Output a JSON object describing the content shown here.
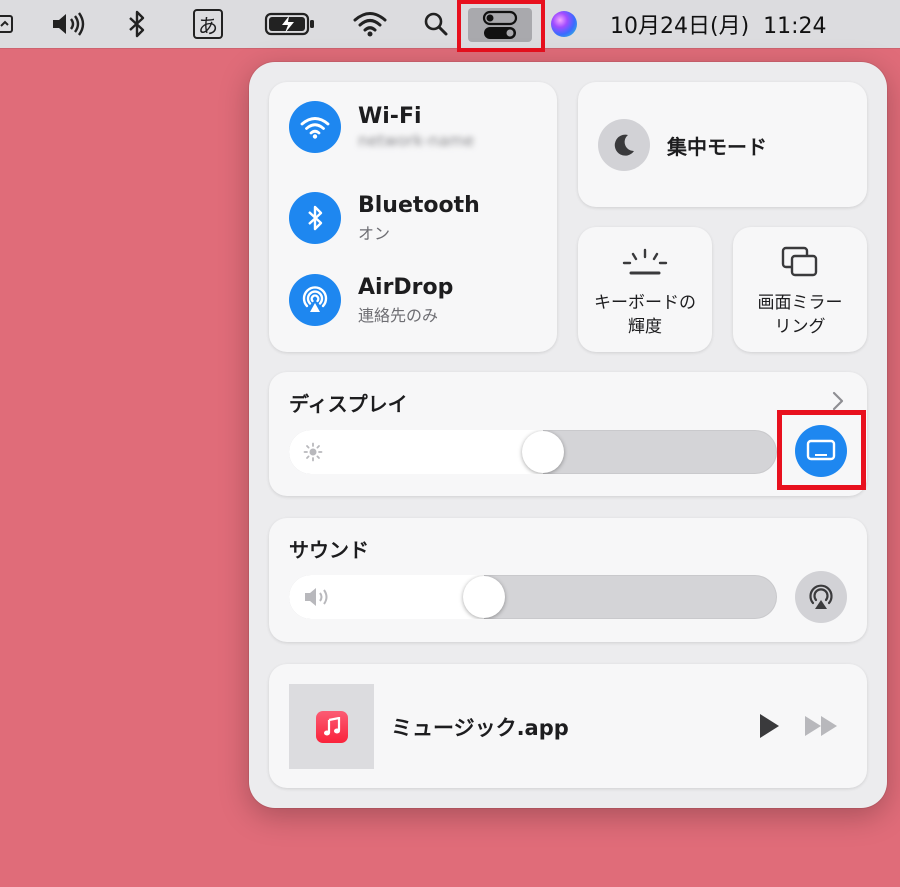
{
  "menubar": {
    "input_mode": "あ",
    "datetime": "10月24日(月)  11:24"
  },
  "network": {
    "wifi": {
      "title": "Wi-Fi",
      "subtitle": "network-name"
    },
    "bluetooth": {
      "title": "Bluetooth",
      "subtitle": "オン"
    },
    "airdrop": {
      "title": "AirDrop",
      "subtitle": "連絡先のみ"
    }
  },
  "focus": {
    "label": "集中モード"
  },
  "keyboard_brightness": {
    "label_line1": "キーボードの",
    "label_line2": "輝度"
  },
  "screen_mirroring": {
    "label_line1": "画面ミラー",
    "label_line2": "リング"
  },
  "display": {
    "title": "ディスプレイ",
    "brightness_level": 0.52
  },
  "sound": {
    "title": "サウンド",
    "volume_level": 0.4
  },
  "now_playing": {
    "app": "ミュージック.app"
  },
  "colors": {
    "accent": "#1e87f0",
    "highlight": "#e8101e",
    "desktop": "#e06c79"
  }
}
